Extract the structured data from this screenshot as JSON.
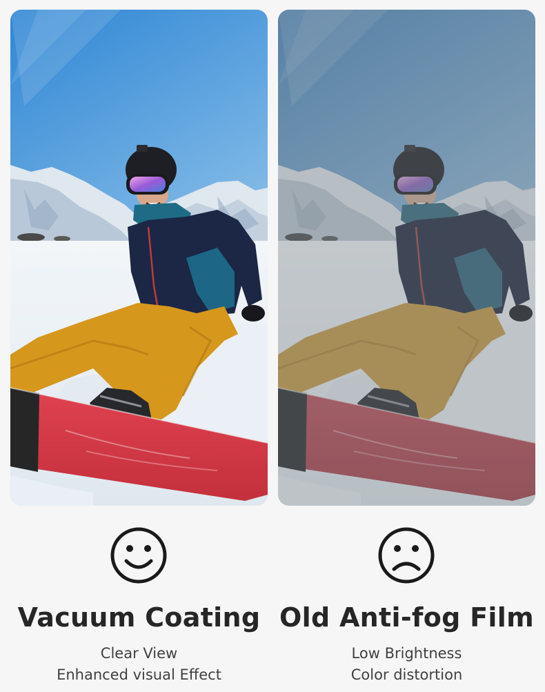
{
  "comparison": {
    "left": {
      "face": "smile-face-icon",
      "title": "Vacuum Coating",
      "lines": [
        "Clear View",
        "Enhanced visual Effect"
      ]
    },
    "right": {
      "face": "sad-face-icon",
      "title": "Old Anti-fog Film",
      "lines": [
        "Low Brightness",
        "Color distortion"
      ]
    }
  },
  "colors": {
    "background": "#f6f6f6",
    "text": "#262626",
    "sky": "#3c8fd6",
    "pants": "#d79a1f",
    "board": "#d63a45"
  }
}
